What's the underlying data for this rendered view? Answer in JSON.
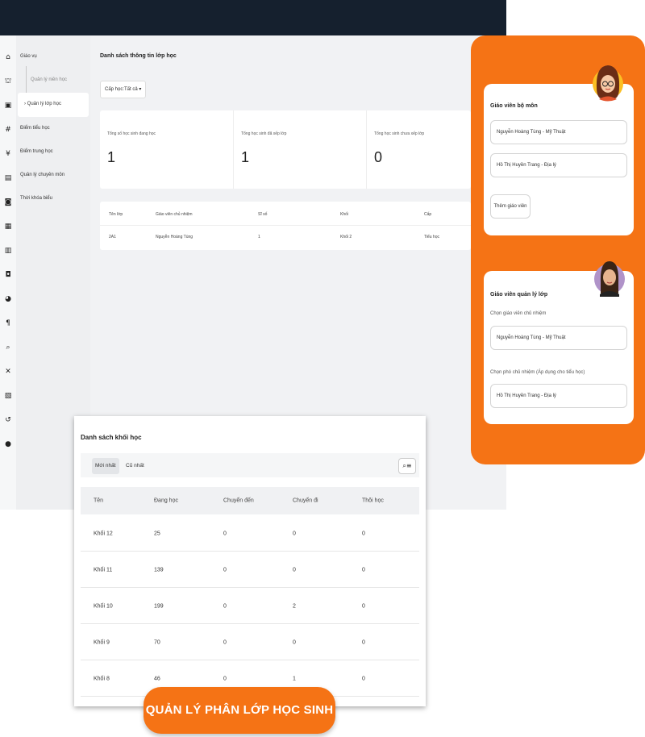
{
  "sidebar": {
    "items": [
      {
        "label": "Giáo vụ"
      },
      {
        "label": "Quản lý niên học"
      },
      {
        "label": "Quản lý lớp học"
      },
      {
        "label": "Điểm tiểu học"
      },
      {
        "label": "Điểm trung học"
      },
      {
        "label": "Quản lý chuyên môn"
      },
      {
        "label": "Thời khóa biểu"
      }
    ]
  },
  "main": {
    "title": "Danh sách thông tin lớp học",
    "filter_label": "Cấp học:Tất cả ▾",
    "stats": [
      {
        "label": "Tổng số học sinh đang học",
        "value": "1"
      },
      {
        "label": "Tổng học sinh đã xếp lớp",
        "value": "1"
      },
      {
        "label": "Tổng học sinh chưa xếp lớp",
        "value": "0"
      }
    ],
    "class_table": {
      "columns": [
        "Tên lớp",
        "Giáo viên chủ nhiệm",
        "Sĩ số",
        "Khối",
        "Cấp"
      ],
      "rows": [
        [
          "2A1",
          "Nguyễn Hoàng Tùng",
          "1",
          "Khối 2",
          "Tiểu học"
        ]
      ]
    }
  },
  "teacher_panel": {
    "subject_title": "Giáo viên bộ môn",
    "subject_teachers": [
      "Nguyễn Hoàng Tùng - Mỹ Thuật",
      "Hồ Thị Huyền Trang - Địa lý"
    ],
    "add_button": "Thêm giáo viên",
    "manager_title": "Giáo viên quản lý lớp",
    "homeroom_label": "Chọn giáo viên chủ nhiệm",
    "homeroom_value": "Nguyễn Hoàng Tùng - Mỹ Thuật",
    "deputy_label": "Chọn phó chủ nhiệm (Áp dụng cho tiểu học)",
    "deputy_value": "Hồ Thị Huyền Trang - Địa lý"
  },
  "grade_list": {
    "title": "Danh sách khối học",
    "tabs": [
      "Mới nhất",
      "Cũ nhất"
    ],
    "columns": [
      "Tên",
      "Đang học",
      "Chuyển đến",
      "Chuyển đi",
      "Thôi học"
    ],
    "rows": [
      [
        "Khối 12",
        "25",
        "0",
        "0",
        "0"
      ],
      [
        "Khối 11",
        "139",
        "0",
        "0",
        "0"
      ],
      [
        "Khối 10",
        "199",
        "0",
        "2",
        "0"
      ],
      [
        "Khối 9",
        "70",
        "0",
        "0",
        "0"
      ],
      [
        "Khối 8",
        "46",
        "0",
        "1",
        "0"
      ]
    ]
  },
  "cta": {
    "label": "QUẢN LÝ PHÂN LỚP HỌC SINH"
  },
  "colors": {
    "accent": "#f57315",
    "topbar": "#15202e"
  }
}
